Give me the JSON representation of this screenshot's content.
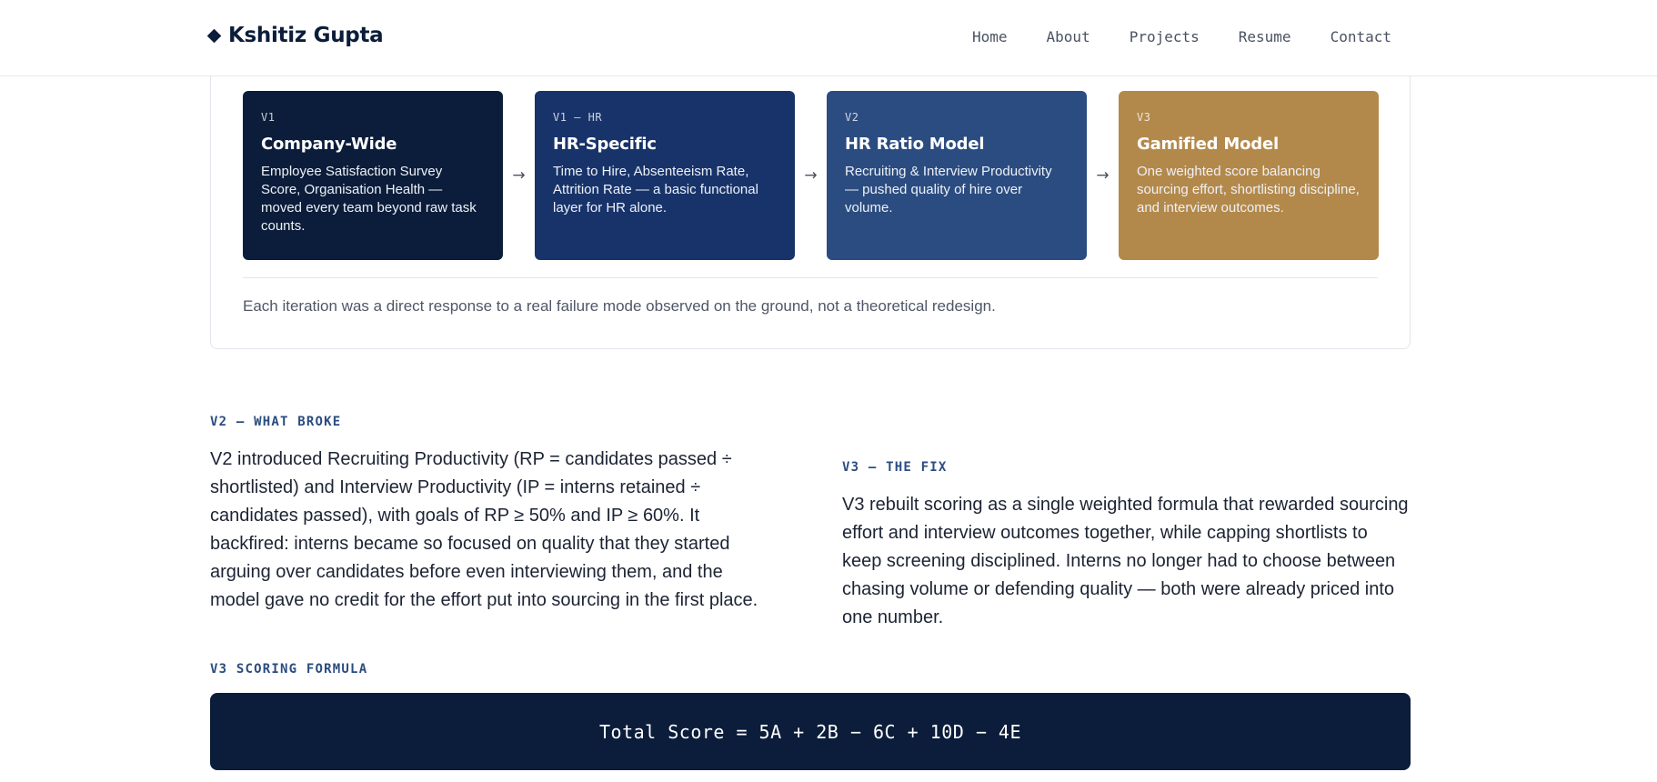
{
  "nav": {
    "brand": "Kshitiz Gupta",
    "links": [
      "Home",
      "About",
      "Projects",
      "Resume",
      "Contact"
    ]
  },
  "timeline": {
    "cards": [
      {
        "tag": "V1",
        "title": "Company-Wide",
        "description": "Employee Satisfaction Survey Score, Organisation Health — moved every team beyond raw task counts.",
        "color": "#0b1d3a"
      },
      {
        "tag": "V1 — HR",
        "title": "HR-Specific",
        "description": "Time to Hire, Absenteeism Rate, Attrition Rate — a basic functional layer for HR alone.",
        "color": "#17336a"
      },
      {
        "tag": "V2",
        "title": "HR Ratio Model",
        "description": "Recruiting & Interview Productivity — pushed quality of hire over volume.",
        "color": "#2b4c80"
      },
      {
        "tag": "V3",
        "title": "Gamified Model",
        "description": "One weighted score balancing sourcing effort, shortlisting discipline, and interview outcomes.",
        "color": "#b3894b"
      }
    ],
    "arrow_icon": "arrow-right-icon",
    "note": "Each iteration was a direct response to a real failure mode observed on the ground, not a theoretical redesign."
  },
  "v2_section": {
    "label": "V2 — WHAT BROKE",
    "text": "V2 introduced Recruiting Productivity (RP = candidates passed ÷ shortlisted) and Interview Productivity (IP = interns retained ÷ candidates passed), with goals of RP ≥ 50% and IP ≥ 60%. It backfired: interns became so focused on quality that they started arguing over candidates before even interviewing them, and the model gave no credit for the effort put into sourcing in the first place."
  },
  "v3_section": {
    "label": "V3 — THE FIX",
    "text": "V3 rebuilt scoring as a single weighted formula that rewarded sourcing effort and interview outcomes together, while capping shortlists to keep screening disciplined. Interns no longer had to choose between chasing volume or defending quality — both were already priced into one number."
  },
  "formula_section": {
    "label": "V3 SCORING FORMULA",
    "formula": "Total Score = 5A + 2B − 6C + 10D − 4E"
  }
}
